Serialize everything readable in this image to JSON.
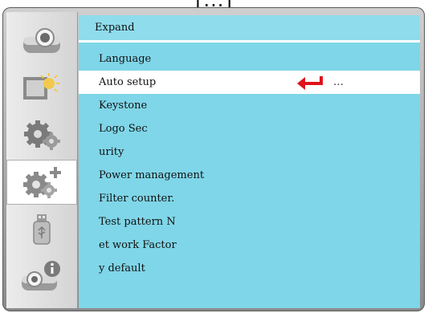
{
  "top_partial_text": "[...]",
  "menu": {
    "title": "Expand",
    "items": [
      {
        "label": "Language"
      },
      {
        "label": "Auto setup",
        "value": "…"
      },
      {
        "label": "Keystone"
      },
      {
        "label": "Logo  Sec"
      },
      {
        "label": "urity"
      },
      {
        "label": "Power management"
      },
      {
        "label": "Filter counter."
      },
      {
        "label": "Test pattern  N"
      },
      {
        "label": "et work  Factor"
      },
      {
        "label": "y default"
      }
    ]
  },
  "sidebar": {
    "items": [
      {
        "icon": "projector-icon"
      },
      {
        "icon": "picture-brightness-icon"
      },
      {
        "icon": "gears-icon"
      },
      {
        "icon": "gears-plus-icon",
        "active": true
      },
      {
        "icon": "usb-icon"
      },
      {
        "icon": "projector-info-icon"
      }
    ]
  },
  "colors": {
    "menu_background": "#7fd6e8",
    "selection": "#ffffff",
    "enter_arrow": "#e0121a"
  }
}
